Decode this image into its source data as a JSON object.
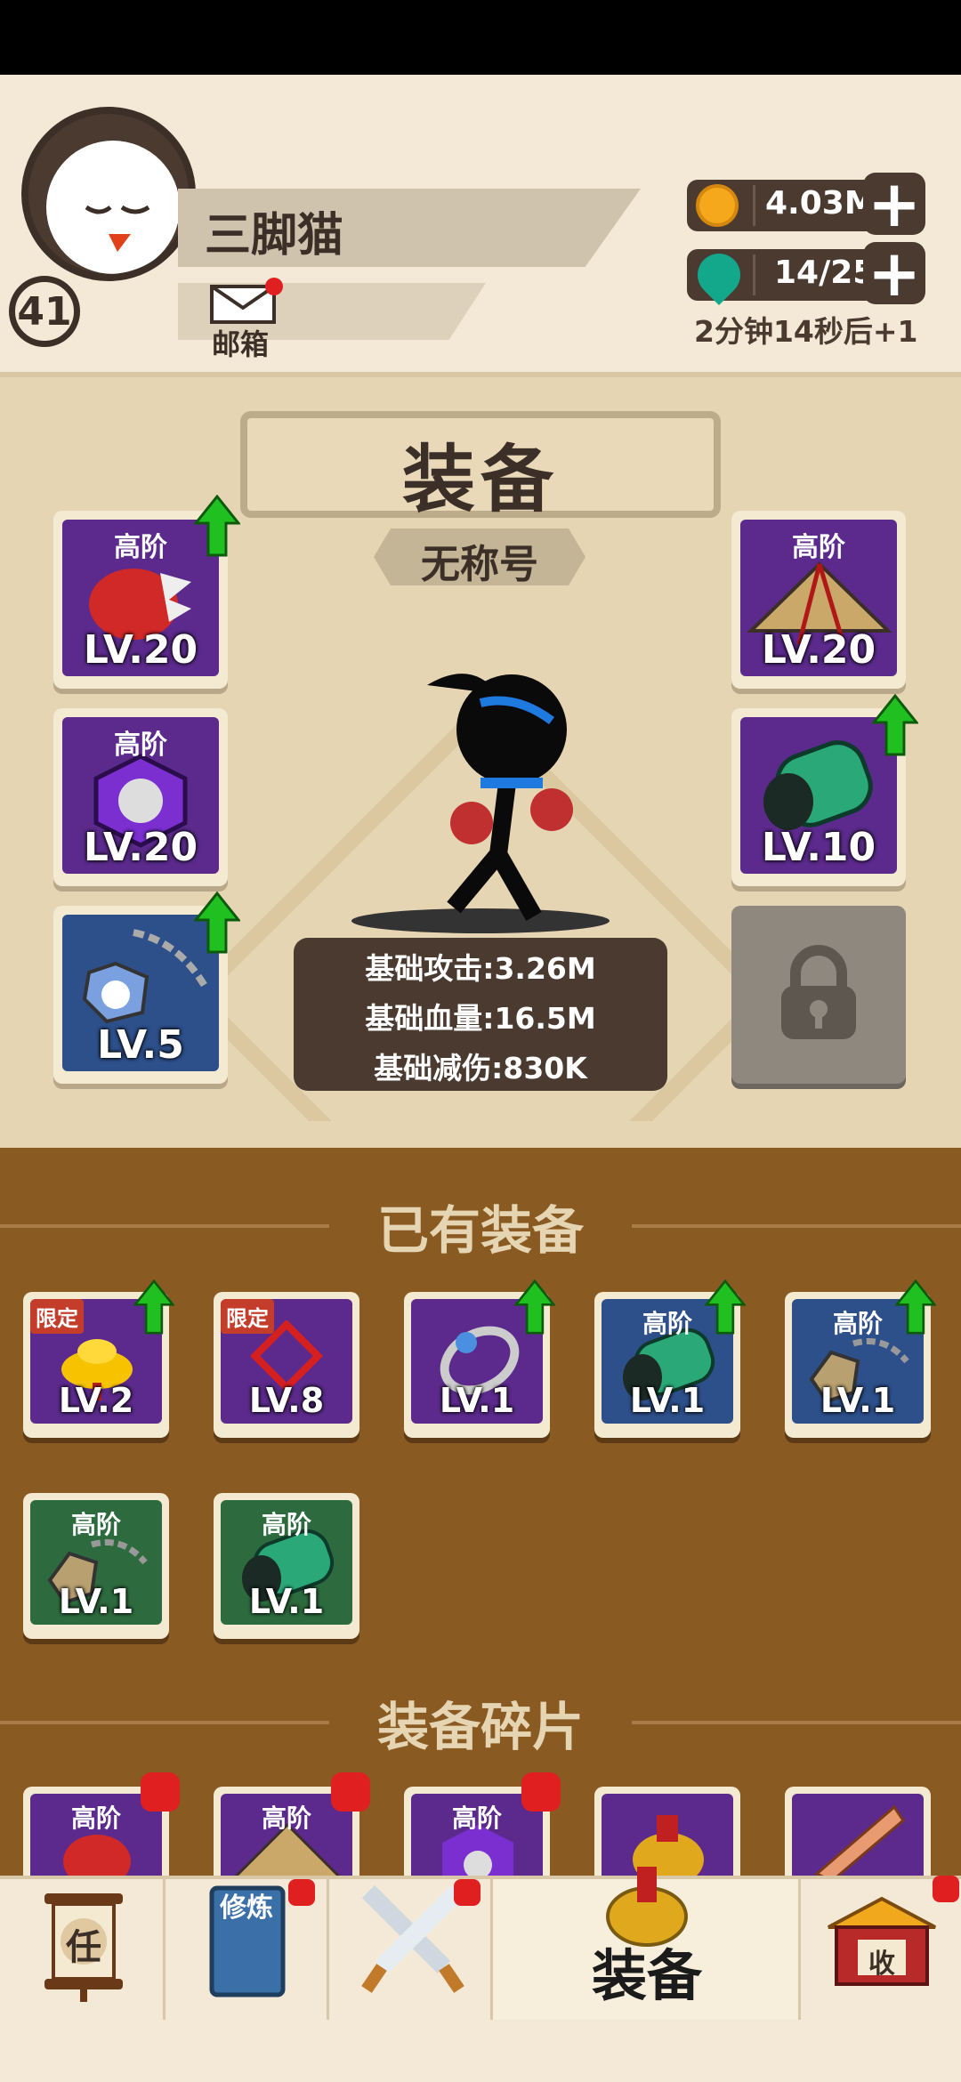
{
  "player": {
    "name": "三脚猫",
    "level": "41",
    "mail_label": "邮箱"
  },
  "resources": {
    "gold": "4.03M",
    "stamina": "14/25",
    "stamina_timer": "2分钟14秒后+1"
  },
  "equipment": {
    "title": "装备",
    "player_title_badge": "无称号",
    "slots_left": [
      {
        "grade": "高阶",
        "level": "LV.20",
        "upgradable": true,
        "item": "red-gauntlet"
      },
      {
        "grade": "高阶",
        "level": "LV.20",
        "upgradable": false,
        "item": "purple-armor"
      },
      {
        "grade": "",
        "level": "LV.5",
        "upgradable": true,
        "item": "gem-necklace"
      }
    ],
    "slots_right": [
      {
        "grade": "高阶",
        "level": "LV.20",
        "upgradable": false,
        "item": "straw-hat"
      },
      {
        "grade": "",
        "level": "LV.10",
        "upgradable": true,
        "item": "green-bracer"
      }
    ],
    "locked_slot": true,
    "stats": [
      "基础攻击:3.26M",
      "基础血量:16.5M",
      "基础减伤:830K"
    ]
  },
  "owned_section_title": "已有装备",
  "owned_items": [
    {
      "tag": "限定",
      "grade": "",
      "level": "LV.2",
      "upgradable": true,
      "color": "purple",
      "item": "gold-ingot"
    },
    {
      "tag": "限定",
      "grade": "",
      "level": "LV.8",
      "upgradable": false,
      "color": "purple",
      "item": "chinese-knot"
    },
    {
      "tag": "",
      "grade": "",
      "level": "LV.1",
      "upgradable": true,
      "color": "purple",
      "item": "ring"
    },
    {
      "tag": "",
      "grade": "高阶",
      "level": "LV.1",
      "upgradable": true,
      "color": "blue",
      "item": "green-bracer"
    },
    {
      "tag": "",
      "grade": "高阶",
      "level": "LV.1",
      "upgradable": true,
      "color": "blue",
      "item": "amulet"
    },
    {
      "tag": "",
      "grade": "高阶",
      "level": "LV.1",
      "upgradable": false,
      "color": "green",
      "item": "amulet"
    },
    {
      "tag": "",
      "grade": "高阶",
      "level": "LV.1",
      "upgradable": false,
      "color": "green",
      "item": "green-bracer"
    }
  ],
  "fragments_section_title": "装备碎片",
  "fragments": [
    {
      "grade": "高阶",
      "badge": true,
      "item": "red-gauntlet"
    },
    {
      "grade": "高阶",
      "badge": true,
      "item": "straw-hat"
    },
    {
      "grade": "高阶",
      "badge": true,
      "item": "purple-armor"
    },
    {
      "grade": "",
      "badge": false,
      "item": "golden-helmet"
    },
    {
      "grade": "",
      "badge": false,
      "item": "wooden-sword"
    }
  ],
  "bottom_nav": {
    "task_glyph": "任",
    "training_glyph": "修炼",
    "equip_label": "装备",
    "collect_glyph": "收"
  },
  "colors": {
    "gold": "#f5a81b",
    "upgrade_arrow": "#20c020",
    "notify_red": "#e02020"
  }
}
